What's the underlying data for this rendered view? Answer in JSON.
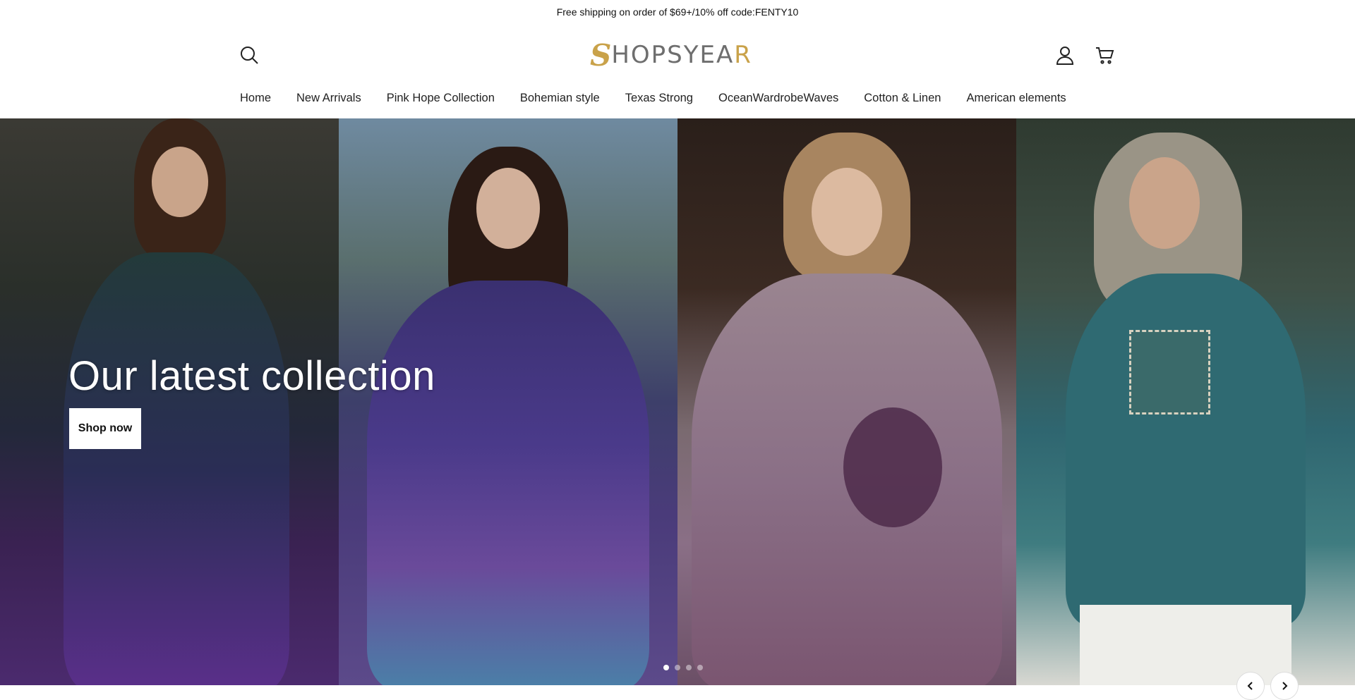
{
  "announcement": {
    "text": "Free shipping on order of $69+/10% off code:FENTY10"
  },
  "header": {
    "logo": {
      "s": "S",
      "rest_a": "HOPSYEA",
      "rest_b": "R"
    },
    "icons": [
      "search-icon",
      "account-icon",
      "cart-icon"
    ]
  },
  "nav": {
    "items": [
      {
        "label": "Home"
      },
      {
        "label": "New Arrivals"
      },
      {
        "label": "Pink Hope Collection"
      },
      {
        "label": "Bohemian style"
      },
      {
        "label": "Texas Strong"
      },
      {
        "label": "OceanWardrobeWaves"
      },
      {
        "label": "Cotton & Linen"
      },
      {
        "label": "American elements"
      }
    ]
  },
  "hero": {
    "title": "Our latest collection",
    "cta_label": "Shop now",
    "slide_count": 4,
    "active_slide": 1
  },
  "colors": {
    "accent_gold": "#c9a24a",
    "logo_gray": "#6e6e6e",
    "text": "#222222"
  }
}
